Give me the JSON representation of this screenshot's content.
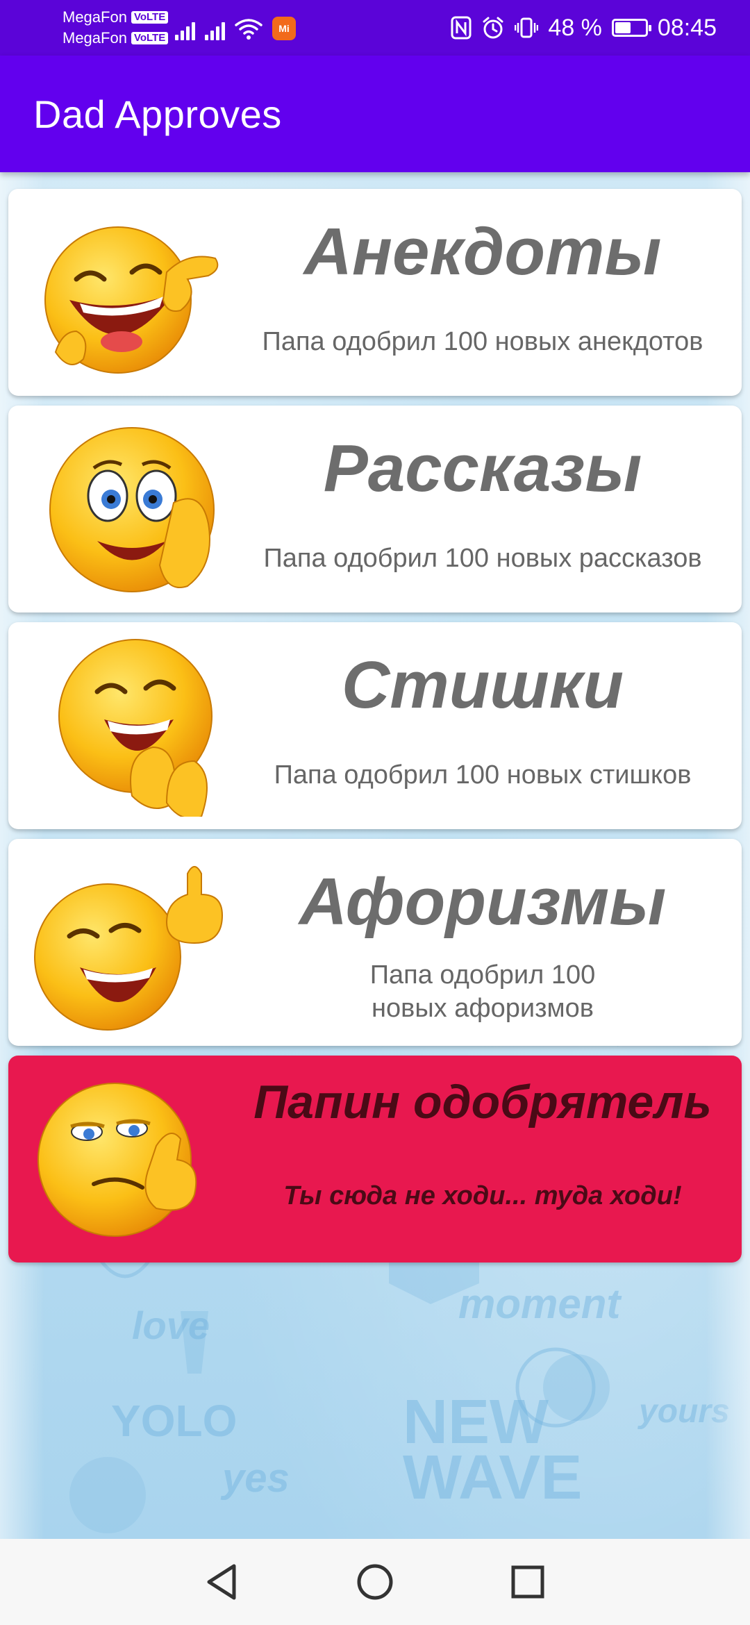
{
  "status_bar": {
    "carrier_1": "MegaFon",
    "carrier_2": "MegaFon",
    "volte_badge": "VoLTE",
    "notif_badge": "Mi",
    "battery_percent": "48 %",
    "battery_level": 0.48,
    "time": "08:45"
  },
  "app_bar": {
    "title": "Dad Approves"
  },
  "cards": [
    {
      "title": "Анекдоты",
      "subtitle": "Папа одобрил 100 новых анекдотов",
      "emoji": "laughing-pointing-emoji-icon"
    },
    {
      "title": "Рассказы",
      "subtitle": "Папа одобрил 100 новых рассказов",
      "emoji": "surprised-whisper-emoji-icon"
    },
    {
      "title": "Стишки",
      "subtitle": "Папа одобрил 100 новых стишков",
      "emoji": "laughing-clapping-emoji-icon"
    },
    {
      "title": "Афоризмы",
      "subtitle": "Папа одобрил 100 новых афоризмов",
      "emoji": "laughing-thumbs-emoji-icon"
    },
    {
      "title": "Папин одобрятель",
      "subtitle": "Ты сюда не ходи... туда ходи!",
      "emoji": "smug-thumbs-emoji-icon"
    }
  ],
  "colors": {
    "status_bar": "#5b04d8",
    "app_bar": "#6200ee",
    "special_card": "#e8184f",
    "card_title": "#6d6d6d"
  },
  "nav_bar": {
    "back": "back-icon",
    "home": "home-icon",
    "recents": "recents-icon"
  }
}
